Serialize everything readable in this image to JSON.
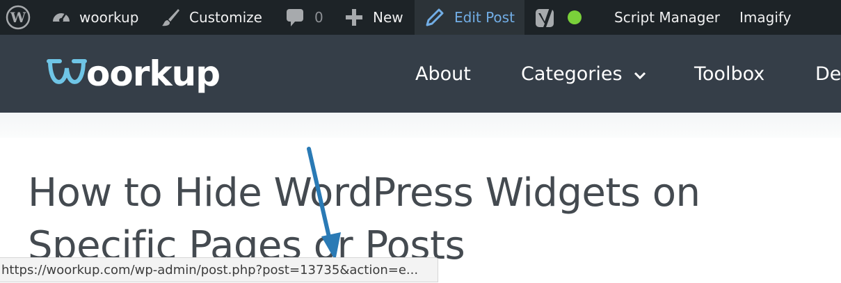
{
  "admin_bar": {
    "site_name": "woorkup",
    "customize_label": "Customize",
    "comments_count": "0",
    "new_label": "New",
    "edit_post_label": "Edit Post",
    "script_manager_label": "Script Manager",
    "imagify_label": "Imagify",
    "icons": [
      "wordpress-icon",
      "dashboard-icon",
      "paintbrush-icon",
      "comment-icon",
      "plus-icon",
      "pencil-icon",
      "yoast-icon",
      "seo-status-dot"
    ],
    "colors": {
      "bar": "#1d2327",
      "active_text": "#72aee6",
      "status_dot": "#7ad03a"
    }
  },
  "site_header": {
    "logo_text": "oorkup",
    "nav": [
      {
        "label": "About"
      },
      {
        "label": "Categories",
        "icon": "chevron-down-icon"
      },
      {
        "label": "Toolbox"
      },
      {
        "label": "De"
      }
    ],
    "colors": {
      "background": "#353e48",
      "logo_accent": "#6fc5e6"
    }
  },
  "post": {
    "title": "How to Hide WordPress Widgets on Specific Pages or Posts"
  },
  "annotation": {
    "color": "#2a7ab5",
    "icon": "arrow-annotation"
  },
  "status_bar": {
    "url": "https://woorkup.com/wp-admin/post.php?post=13735&action=e..."
  }
}
